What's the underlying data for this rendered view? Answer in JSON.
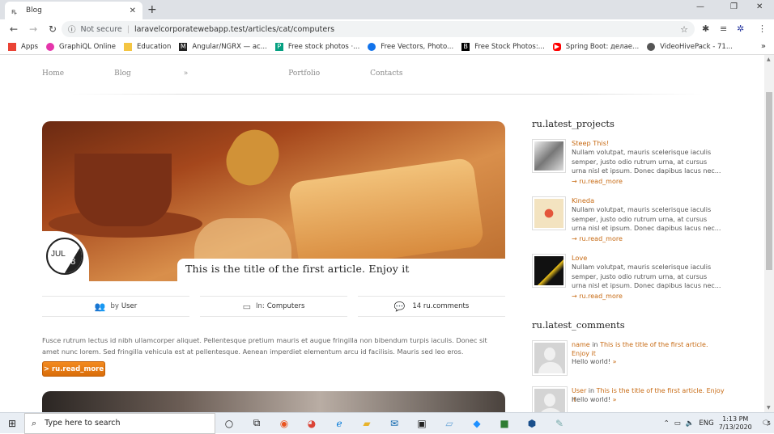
{
  "browser": {
    "tab_title": "Blog",
    "tab_favicon": "wordpress-like-icon",
    "not_secure": "Not secure",
    "url": "laravelcorporatewebapp.test/articles/cat/computers",
    "bookmarks": [
      {
        "label": "Apps",
        "color": "#ea4335"
      },
      {
        "label": "GraphiQL Online",
        "color": "#e535ab"
      },
      {
        "label": "Education",
        "color": "#f4c542"
      },
      {
        "label": "Angular/NGRX — ас...",
        "color": "#222222"
      },
      {
        "label": "Free stock photos ·...",
        "color": "#05a081"
      },
      {
        "label": "Free Vectors, Photo...",
        "color": "#1273eb"
      },
      {
        "label": "Free Stock Photos:...",
        "color": "#000000"
      },
      {
        "label": "Spring Boot: делае...",
        "color": "#ff0000"
      },
      {
        "label": "VideoHivePack - 71...",
        "color": "#555555"
      }
    ]
  },
  "site": {
    "nav": [
      "Home",
      "Blog",
      "Portfolio",
      "Contacts"
    ],
    "blog_arrow": "»"
  },
  "article": {
    "month": "JUL",
    "day": "18",
    "title": "This is the title of the first article. Enjoy it",
    "by_label": "by",
    "author": "User",
    "in_label": "In:",
    "category": "Computers",
    "comments": "14 ru.comments",
    "excerpt": "Fusce rutrum lectus id nibh ullamcorper aliquet. Pellentesque pretium mauris et augue fringilla non bibendum turpis iaculis. Donec sit amet nunc lorem. Sed fringilla vehicula est at pellentesque. Aenean imperdiet elementum arcu id facilisis. Mauris sed leo eros.",
    "read_more": "> ru.read_more"
  },
  "sidebar": {
    "projects_head": "ru.latest_projects",
    "projects": [
      {
        "name": "Steep This!",
        "desc": "Nullam volutpat, mauris scelerisque iaculis semper, justo odio rutrum urna, at cursus urna nisl et ipsum. Donec dapibus lacus nec...",
        "more": "→ ru.read_more",
        "thumb_color": "#9a9a9a"
      },
      {
        "name": "Kineda",
        "desc": "Nullam volutpat, mauris scelerisque iaculis semper, justo odio rutrum urna, at cursus urna nisl et ipsum. Donec dapibus lacus nec...",
        "more": "→ ru.read_more",
        "thumb_color": "#f3e3c0"
      },
      {
        "name": "Love",
        "desc": "Nullam volutpat, mauris scelerisque iaculis semper, justo odio rutrum urna, at cursus urna nisl et ipsum. Donec dapibus lacus nec...",
        "more": "→ ru.read_more",
        "thumb_color": "#2a2a2a"
      }
    ],
    "comments_head": "ru.latest_comments",
    "comments": [
      {
        "who": "name",
        "in": "in",
        "target": "This is the title of the first article. Enjoy it",
        "text": "Hello world!",
        "arrow": "»"
      },
      {
        "who": "User",
        "in": "in",
        "target": "This is the title of the first article. Enjoy it",
        "text": "Hello world!",
        "arrow": "»"
      }
    ]
  },
  "taskbar": {
    "search_placeholder": "Type here to search",
    "lang": "ENG",
    "time": "1:13 PM",
    "date": "7/13/2020",
    "notif_count": "5"
  }
}
